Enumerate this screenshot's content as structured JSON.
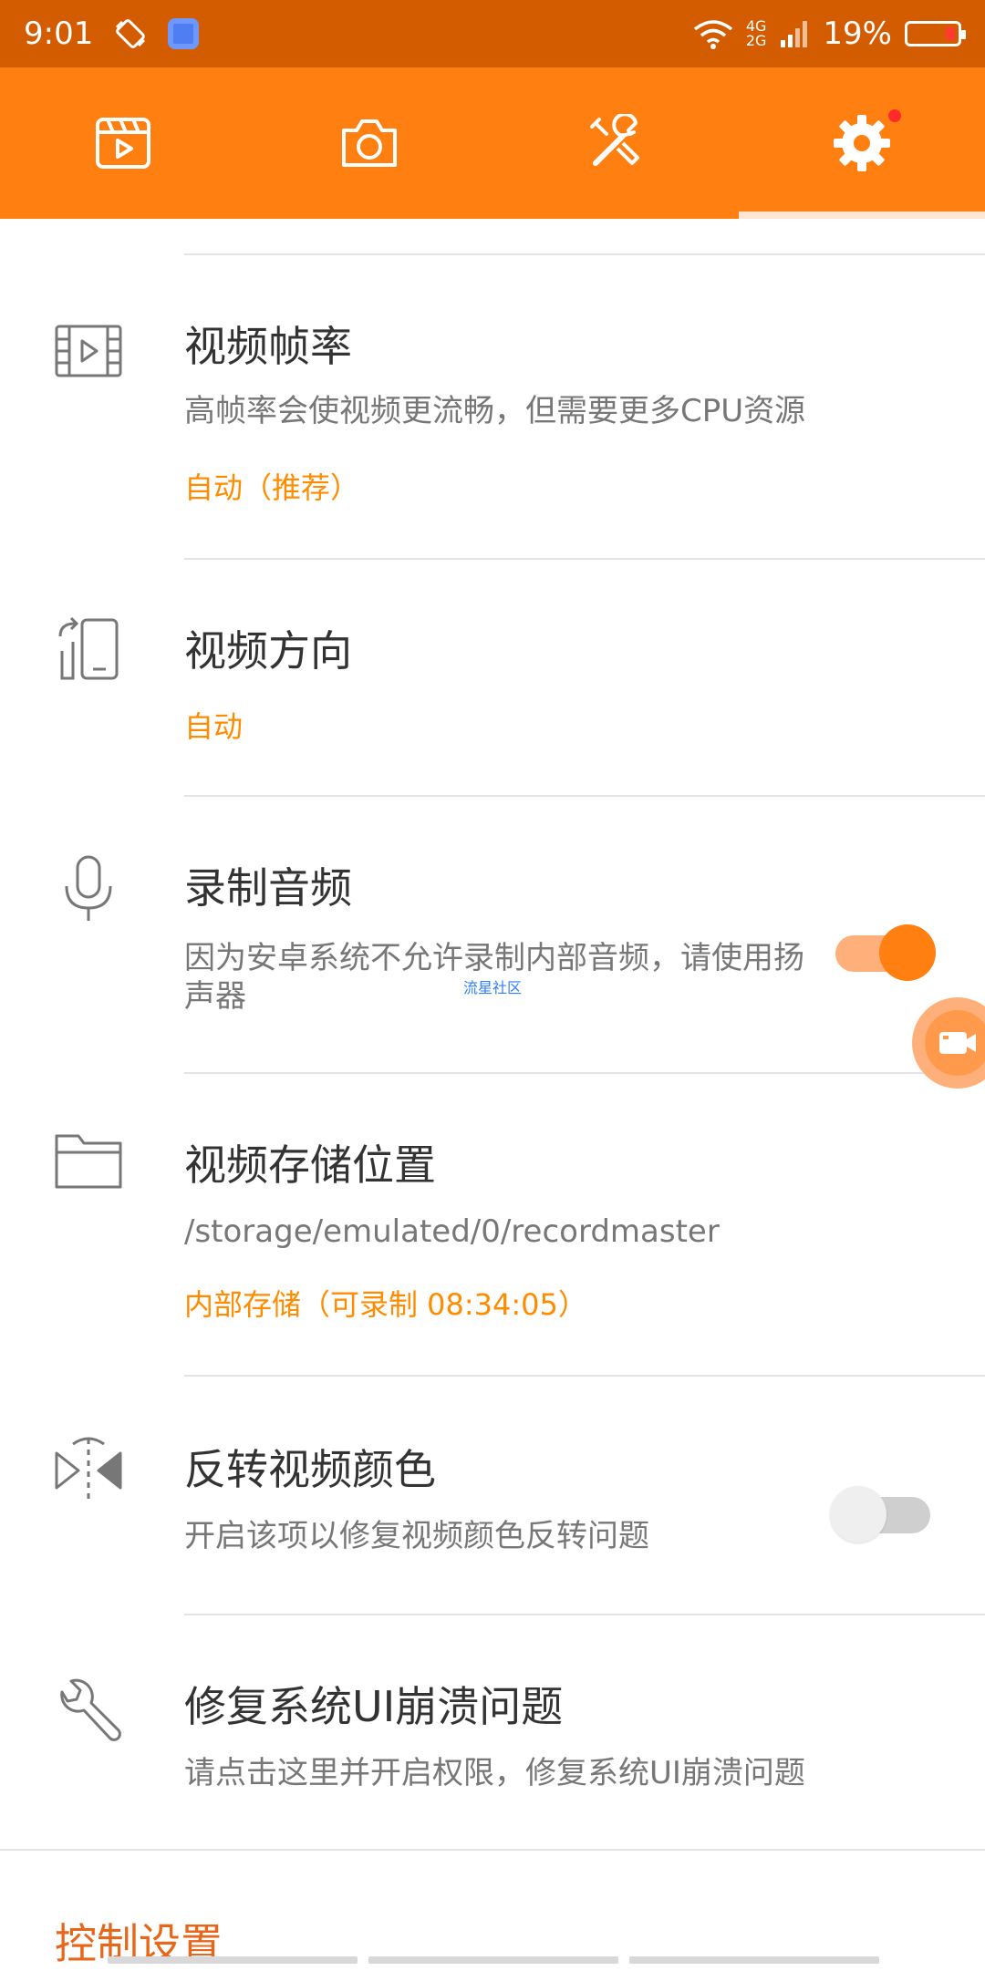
{
  "status_bar": {
    "time": "9:01",
    "net_top": "4G",
    "net_bottom": "2G",
    "battery": "19%"
  },
  "tabs": [
    {
      "name": "video-list",
      "icon": "video-play-icon"
    },
    {
      "name": "screenshot",
      "icon": "camera-icon"
    },
    {
      "name": "tools",
      "icon": "tools-icon"
    },
    {
      "name": "settings",
      "icon": "gear-icon",
      "active": true,
      "badge": true
    }
  ],
  "settings": {
    "frame_rate": {
      "title": "视频帧率",
      "desc": "高帧率会使视频更流畅，但需要更多CPU资源",
      "value": "自动（推荐）"
    },
    "orientation": {
      "title": "视频方向",
      "value": "自动"
    },
    "record_audio": {
      "title": "录制音频",
      "desc": "因为安卓系统不允许录制内部音频，请使用扬声器",
      "enabled": true
    },
    "storage": {
      "title": "视频存储位置",
      "path": "/storage/emulated/0/recordmaster",
      "value": "内部存储（可录制 08:34:05）"
    },
    "invert_color": {
      "title": "反转视频颜色",
      "desc": "开启该项以修复视频颜色反转问题",
      "enabled": false
    },
    "fix_ui": {
      "title": "修复系统UI崩溃问题",
      "desc": "请点击这里并开启权限，修复系统UI崩溃问题"
    }
  },
  "section_header": "控制设置",
  "watermark": "流星社区",
  "colors": {
    "status_bar": "#d45c00",
    "accent": "#ff7f11",
    "value_text": "#ff8c00",
    "section_header": "#e8661a"
  }
}
